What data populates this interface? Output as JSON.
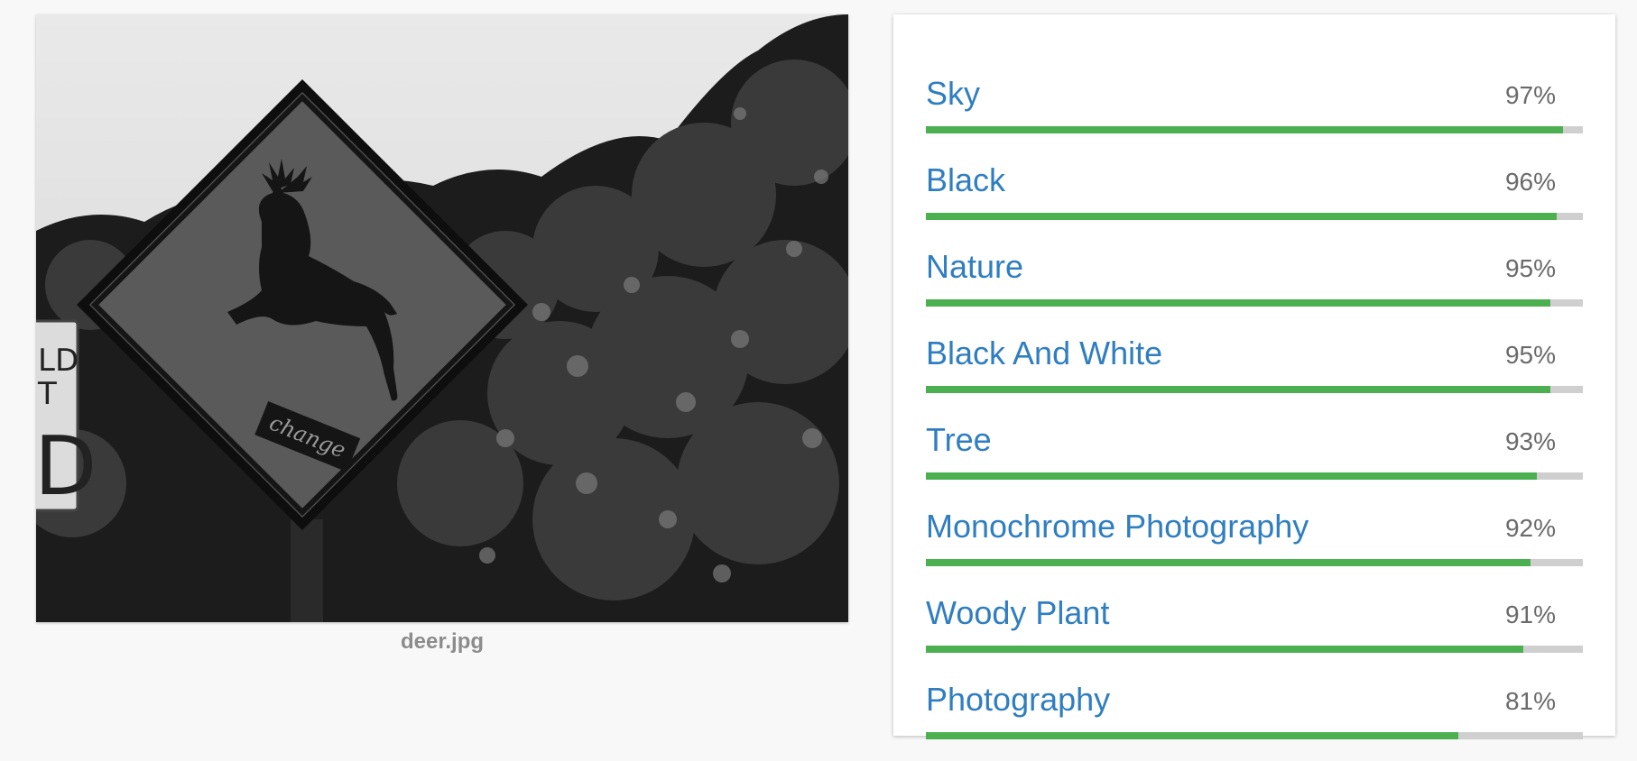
{
  "image": {
    "filename": "deer.jpg",
    "sign_text": "change",
    "side_sign_lines": [
      "LD",
      "T",
      "D"
    ]
  },
  "colors": {
    "label": "#2f7ec1",
    "fill": "#4caf50",
    "track": "#cfcfcf"
  },
  "labels": [
    {
      "name": "Sky",
      "percent": "97%",
      "score": 97
    },
    {
      "name": "Black",
      "percent": "96%",
      "score": 96
    },
    {
      "name": "Nature",
      "percent": "95%",
      "score": 95
    },
    {
      "name": "Black And White",
      "percent": "95%",
      "score": 95
    },
    {
      "name": "Tree",
      "percent": "93%",
      "score": 93
    },
    {
      "name": "Monochrome Photography",
      "percent": "92%",
      "score": 92
    },
    {
      "name": "Woody Plant",
      "percent": "91%",
      "score": 91
    },
    {
      "name": "Photography",
      "percent": "81%",
      "score": 81
    }
  ]
}
